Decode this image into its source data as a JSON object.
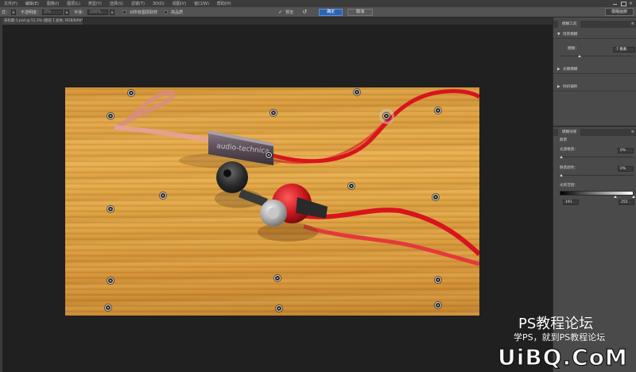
{
  "menubar": {
    "items": [
      "文件(F)",
      "编辑(E)",
      "图像(I)",
      "图层(L)",
      "类型(Y)",
      "选择(S)",
      "滤镜(T)",
      "3D(D)",
      "视图(V)",
      "窗口(W)",
      "帮助(H)"
    ]
  },
  "options": {
    "tool_label": "式：",
    "opacity_label": "不透明度：",
    "opacity_value": "0%",
    "flow_label": "平滑：",
    "flow_value": "100%",
    "sample_check_label": "对所有图层取样",
    "hq_check_label": "高品质",
    "preview_label": "预览",
    "ok_label": "确定",
    "cancel_label": "取消",
    "workspace_label": "模糊画廊"
  },
  "document": {
    "tab_label": "未标题-1.psd @ 51.3% (图层 1 副本, RGB/8#) *"
  },
  "right_panel": {
    "tools_tab": "模糊工具",
    "sections": {
      "field_blur": "场景模糊",
      "iris_blur": "光圈模糊",
      "tilt_shift": "倾斜偏移"
    },
    "blur_label": "模糊：",
    "blur_value": "7 像素",
    "effects_tab": "模糊效果",
    "bokeh_heading": "散景",
    "light_bokeh_label": "光源散景：",
    "light_bokeh_value": "0%",
    "bokeh_color_label": "散景颜色：",
    "bokeh_color_value": "0%",
    "light_range_label": "光照范围：",
    "light_range_min": "191",
    "light_range_max": "255"
  },
  "watermark": {
    "line1": "PS教程论坛",
    "line2": "学PS，就到PS教程论坛",
    "line3": "UiBQ.CoM"
  },
  "colors": {
    "cable_red": "#d8141c",
    "wood": "#e0a445",
    "ok_blue": "#2d63b0"
  }
}
